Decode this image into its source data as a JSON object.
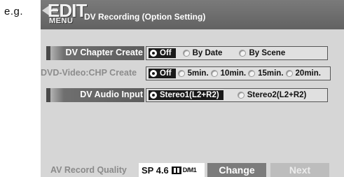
{
  "caption": "e.g.",
  "header": {
    "logo_main": "EDIT",
    "logo_sub": "MENU",
    "title": "DV Recording (Option Setting)"
  },
  "rows": [
    {
      "label": "DV Chapter Create",
      "options": [
        {
          "label": "Off",
          "selected": true
        },
        {
          "label": "By Date",
          "selected": false
        },
        {
          "label": "By Scene",
          "selected": false
        }
      ]
    },
    {
      "label": "DVD-Video:CHP Create",
      "options": [
        {
          "label": "Off",
          "selected": true
        },
        {
          "label": "5min.",
          "selected": false
        },
        {
          "label": "10min.",
          "selected": false
        },
        {
          "label": "15min.",
          "selected": false
        },
        {
          "label": "20min.",
          "selected": false
        }
      ]
    },
    {
      "label": "DV Audio Input",
      "options": [
        {
          "label": "Stereo1(L2+R2)",
          "selected": true
        },
        {
          "label": "Stereo2(L2+R2)",
          "selected": false
        }
      ]
    }
  ],
  "footer": {
    "quality_label": "AV Record Quality",
    "quality_value": "SP 4.6",
    "quality_sub": "D/M1",
    "change_label": "Change",
    "next_label": "Next"
  },
  "colors": {
    "header_bg": "#6b6b6b",
    "screen_bg": "#d6d6d6",
    "selected_bg": "#1a1a1a"
  }
}
